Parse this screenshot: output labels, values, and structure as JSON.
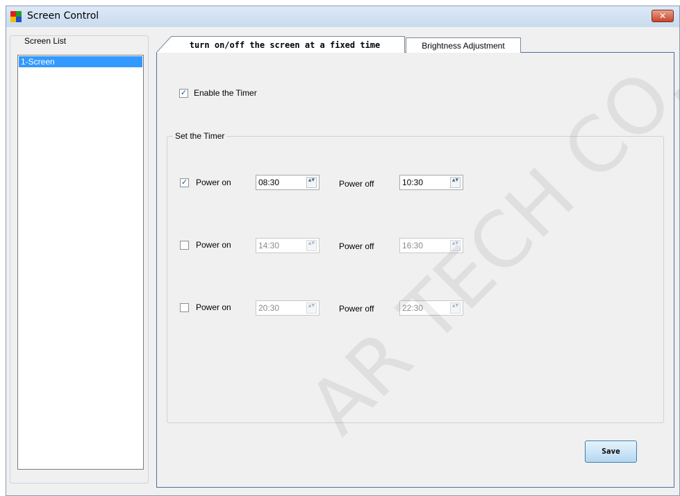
{
  "window": {
    "title": "Screen Control",
    "close_glyph": "✕"
  },
  "screen_list": {
    "label": "Screen List",
    "items": [
      "1-Screen"
    ]
  },
  "tabs": [
    {
      "label": "turn on/off the screen at a fixed time",
      "active": true
    },
    {
      "label": "Brightness Adjustment",
      "active": false
    }
  ],
  "timer": {
    "enable_label": "Enable the Timer",
    "enable_checked": true,
    "group_label": "Set the Timer",
    "check_glyph": "✓",
    "spin_glyph": "▲▼",
    "rows": [
      {
        "checked": true,
        "power_on_label": "Power on",
        "power_on": "08:30",
        "power_off_label": "Power off",
        "power_off": "10:30"
      },
      {
        "checked": false,
        "power_on_label": "Power on",
        "power_on": "14:30",
        "power_off_label": "Power off",
        "power_off": "16:30"
      },
      {
        "checked": false,
        "power_on_label": "Power on",
        "power_on": "20:30",
        "power_off_label": "Power off",
        "power_off": "22:30"
      }
    ]
  },
  "save_label": "Save",
  "watermark": "AR TECH CO., L",
  "colors": {
    "selection": "#3399ff",
    "close": "#c8452c",
    "accent_border": "#4b6f9c"
  }
}
